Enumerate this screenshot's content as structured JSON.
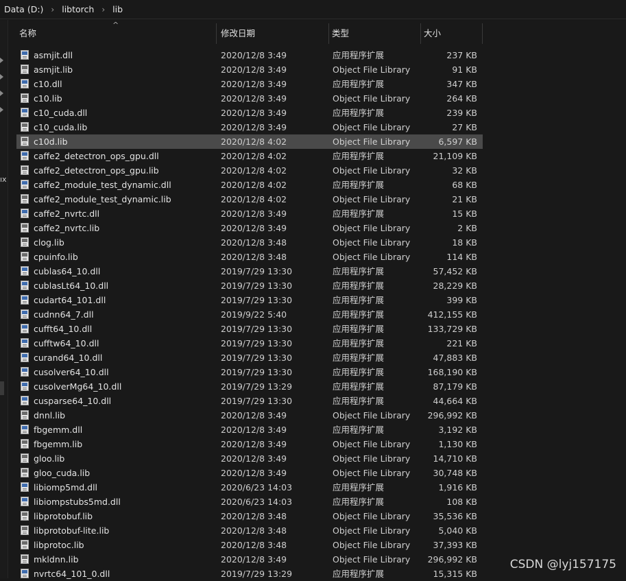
{
  "breadcrumb": [
    "Data (D:)",
    "libtorch",
    "lib"
  ],
  "left_pane_label": "ıx",
  "columns": {
    "name": "名称",
    "date": "修改日期",
    "type": "类型",
    "size": "大小"
  },
  "sort_indicator": "^",
  "selected_row": 6,
  "files": [
    {
      "name": "asmjit.dll",
      "date": "2020/12/8 3:49",
      "type": "应用程序扩展",
      "size": "237 KB",
      "icon": "dll-file-icon"
    },
    {
      "name": "asmjit.lib",
      "date": "2020/12/8 3:49",
      "type": "Object File Library",
      "size": "91 KB",
      "icon": "lib-file-icon"
    },
    {
      "name": "c10.dll",
      "date": "2020/12/8 3:49",
      "type": "应用程序扩展",
      "size": "347 KB",
      "icon": "dll-file-icon"
    },
    {
      "name": "c10.lib",
      "date": "2020/12/8 3:49",
      "type": "Object File Library",
      "size": "264 KB",
      "icon": "lib-file-icon"
    },
    {
      "name": "c10_cuda.dll",
      "date": "2020/12/8 3:49",
      "type": "应用程序扩展",
      "size": "239 KB",
      "icon": "dll-file-icon"
    },
    {
      "name": "c10_cuda.lib",
      "date": "2020/12/8 3:49",
      "type": "Object File Library",
      "size": "27 KB",
      "icon": "lib-file-icon"
    },
    {
      "name": "c10d.lib",
      "date": "2020/12/8 4:02",
      "type": "Object File Library",
      "size": "6,597 KB",
      "icon": "lib-file-icon"
    },
    {
      "name": "caffe2_detectron_ops_gpu.dll",
      "date": "2020/12/8 4:02",
      "type": "应用程序扩展",
      "size": "21,109 KB",
      "icon": "dll-file-icon"
    },
    {
      "name": "caffe2_detectron_ops_gpu.lib",
      "date": "2020/12/8 4:02",
      "type": "Object File Library",
      "size": "32 KB",
      "icon": "lib-file-icon"
    },
    {
      "name": "caffe2_module_test_dynamic.dll",
      "date": "2020/12/8 4:02",
      "type": "应用程序扩展",
      "size": "68 KB",
      "icon": "dll-file-icon"
    },
    {
      "name": "caffe2_module_test_dynamic.lib",
      "date": "2020/12/8 4:02",
      "type": "Object File Library",
      "size": "21 KB",
      "icon": "lib-file-icon"
    },
    {
      "name": "caffe2_nvrtc.dll",
      "date": "2020/12/8 3:49",
      "type": "应用程序扩展",
      "size": "15 KB",
      "icon": "dll-file-icon"
    },
    {
      "name": "caffe2_nvrtc.lib",
      "date": "2020/12/8 3:49",
      "type": "Object File Library",
      "size": "2 KB",
      "icon": "lib-file-icon"
    },
    {
      "name": "clog.lib",
      "date": "2020/12/8 3:48",
      "type": "Object File Library",
      "size": "18 KB",
      "icon": "lib-file-icon"
    },
    {
      "name": "cpuinfo.lib",
      "date": "2020/12/8 3:48",
      "type": "Object File Library",
      "size": "114 KB",
      "icon": "lib-file-icon"
    },
    {
      "name": "cublas64_10.dll",
      "date": "2019/7/29 13:30",
      "type": "应用程序扩展",
      "size": "57,452 KB",
      "icon": "dll-file-icon"
    },
    {
      "name": "cublasLt64_10.dll",
      "date": "2019/7/29 13:30",
      "type": "应用程序扩展",
      "size": "28,229 KB",
      "icon": "dll-file-icon"
    },
    {
      "name": "cudart64_101.dll",
      "date": "2019/7/29 13:30",
      "type": "应用程序扩展",
      "size": "399 KB",
      "icon": "dll-file-icon"
    },
    {
      "name": "cudnn64_7.dll",
      "date": "2019/9/22 5:40",
      "type": "应用程序扩展",
      "size": "412,155 KB",
      "icon": "dll-file-icon"
    },
    {
      "name": "cufft64_10.dll",
      "date": "2019/7/29 13:30",
      "type": "应用程序扩展",
      "size": "133,729 KB",
      "icon": "dll-file-icon"
    },
    {
      "name": "cufftw64_10.dll",
      "date": "2019/7/29 13:30",
      "type": "应用程序扩展",
      "size": "221 KB",
      "icon": "dll-file-icon"
    },
    {
      "name": "curand64_10.dll",
      "date": "2019/7/29 13:30",
      "type": "应用程序扩展",
      "size": "47,883 KB",
      "icon": "dll-file-icon"
    },
    {
      "name": "cusolver64_10.dll",
      "date": "2019/7/29 13:30",
      "type": "应用程序扩展",
      "size": "168,190 KB",
      "icon": "dll-file-icon"
    },
    {
      "name": "cusolverMg64_10.dll",
      "date": "2019/7/29 13:29",
      "type": "应用程序扩展",
      "size": "87,179 KB",
      "icon": "dll-file-icon"
    },
    {
      "name": "cusparse64_10.dll",
      "date": "2019/7/29 13:30",
      "type": "应用程序扩展",
      "size": "44,664 KB",
      "icon": "dll-file-icon"
    },
    {
      "name": "dnnl.lib",
      "date": "2020/12/8 3:49",
      "type": "Object File Library",
      "size": "296,992 KB",
      "icon": "lib-file-icon"
    },
    {
      "name": "fbgemm.dll",
      "date": "2020/12/8 3:49",
      "type": "应用程序扩展",
      "size": "3,192 KB",
      "icon": "dll-file-icon"
    },
    {
      "name": "fbgemm.lib",
      "date": "2020/12/8 3:49",
      "type": "Object File Library",
      "size": "1,130 KB",
      "icon": "lib-file-icon"
    },
    {
      "name": "gloo.lib",
      "date": "2020/12/8 3:49",
      "type": "Object File Library",
      "size": "14,710 KB",
      "icon": "lib-file-icon"
    },
    {
      "name": "gloo_cuda.lib",
      "date": "2020/12/8 3:49",
      "type": "Object File Library",
      "size": "30,748 KB",
      "icon": "lib-file-icon"
    },
    {
      "name": "libiomp5md.dll",
      "date": "2020/6/23 14:03",
      "type": "应用程序扩展",
      "size": "1,916 KB",
      "icon": "dll-file-icon"
    },
    {
      "name": "libiompstubs5md.dll",
      "date": "2020/6/23 14:03",
      "type": "应用程序扩展",
      "size": "108 KB",
      "icon": "dll-file-icon"
    },
    {
      "name": "libprotobuf.lib",
      "date": "2020/12/8 3:48",
      "type": "Object File Library",
      "size": "35,536 KB",
      "icon": "lib-file-icon"
    },
    {
      "name": "libprotobuf-lite.lib",
      "date": "2020/12/8 3:48",
      "type": "Object File Library",
      "size": "5,040 KB",
      "icon": "lib-file-icon"
    },
    {
      "name": "libprotoc.lib",
      "date": "2020/12/8 3:48",
      "type": "Object File Library",
      "size": "37,393 KB",
      "icon": "lib-file-icon"
    },
    {
      "name": "mkldnn.lib",
      "date": "2020/12/8 3:49",
      "type": "Object File Library",
      "size": "296,992 KB",
      "icon": "lib-file-icon"
    },
    {
      "name": "nvrtc64_101_0.dll",
      "date": "2019/7/29 13:29",
      "type": "应用程序扩展",
      "size": "15,315 KB",
      "icon": "dll-file-icon"
    }
  ],
  "watermark": "CSDN @lyj157175"
}
